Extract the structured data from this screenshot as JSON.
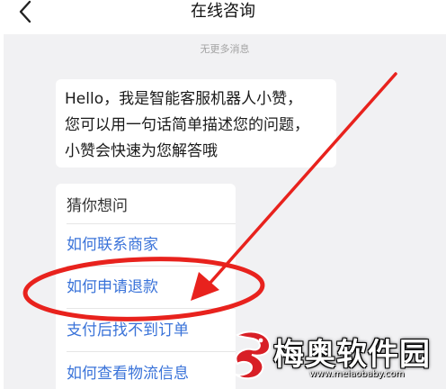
{
  "header": {
    "title": "在线咨询",
    "back_icon": "chevron-left-icon"
  },
  "chat": {
    "no_more_text": "无更多消息",
    "bot_message": {
      "lines": [
        "Hello，我是智能客服机器人小赞，",
        "您可以用一句话简单描述您的问题，",
        "小赞会快速为您解答哦"
      ]
    },
    "suggestions": {
      "title": "猜你想问",
      "items": [
        "如何联系商家",
        "如何申请退款",
        "支付后找不到订单",
        "如何查看物流信息"
      ]
    }
  },
  "annotation": {
    "color": "#e8221d",
    "highlighted_item": "如何申请退款"
  },
  "watermark": {
    "name": "梅奥软件园",
    "url": "www.meiaobaby.com",
    "logo_icon": "dragon-logo-icon"
  },
  "colors": {
    "link": "#3a73d9",
    "chat_bg": "#f1f1f3",
    "annotation_red": "#e8221d"
  }
}
